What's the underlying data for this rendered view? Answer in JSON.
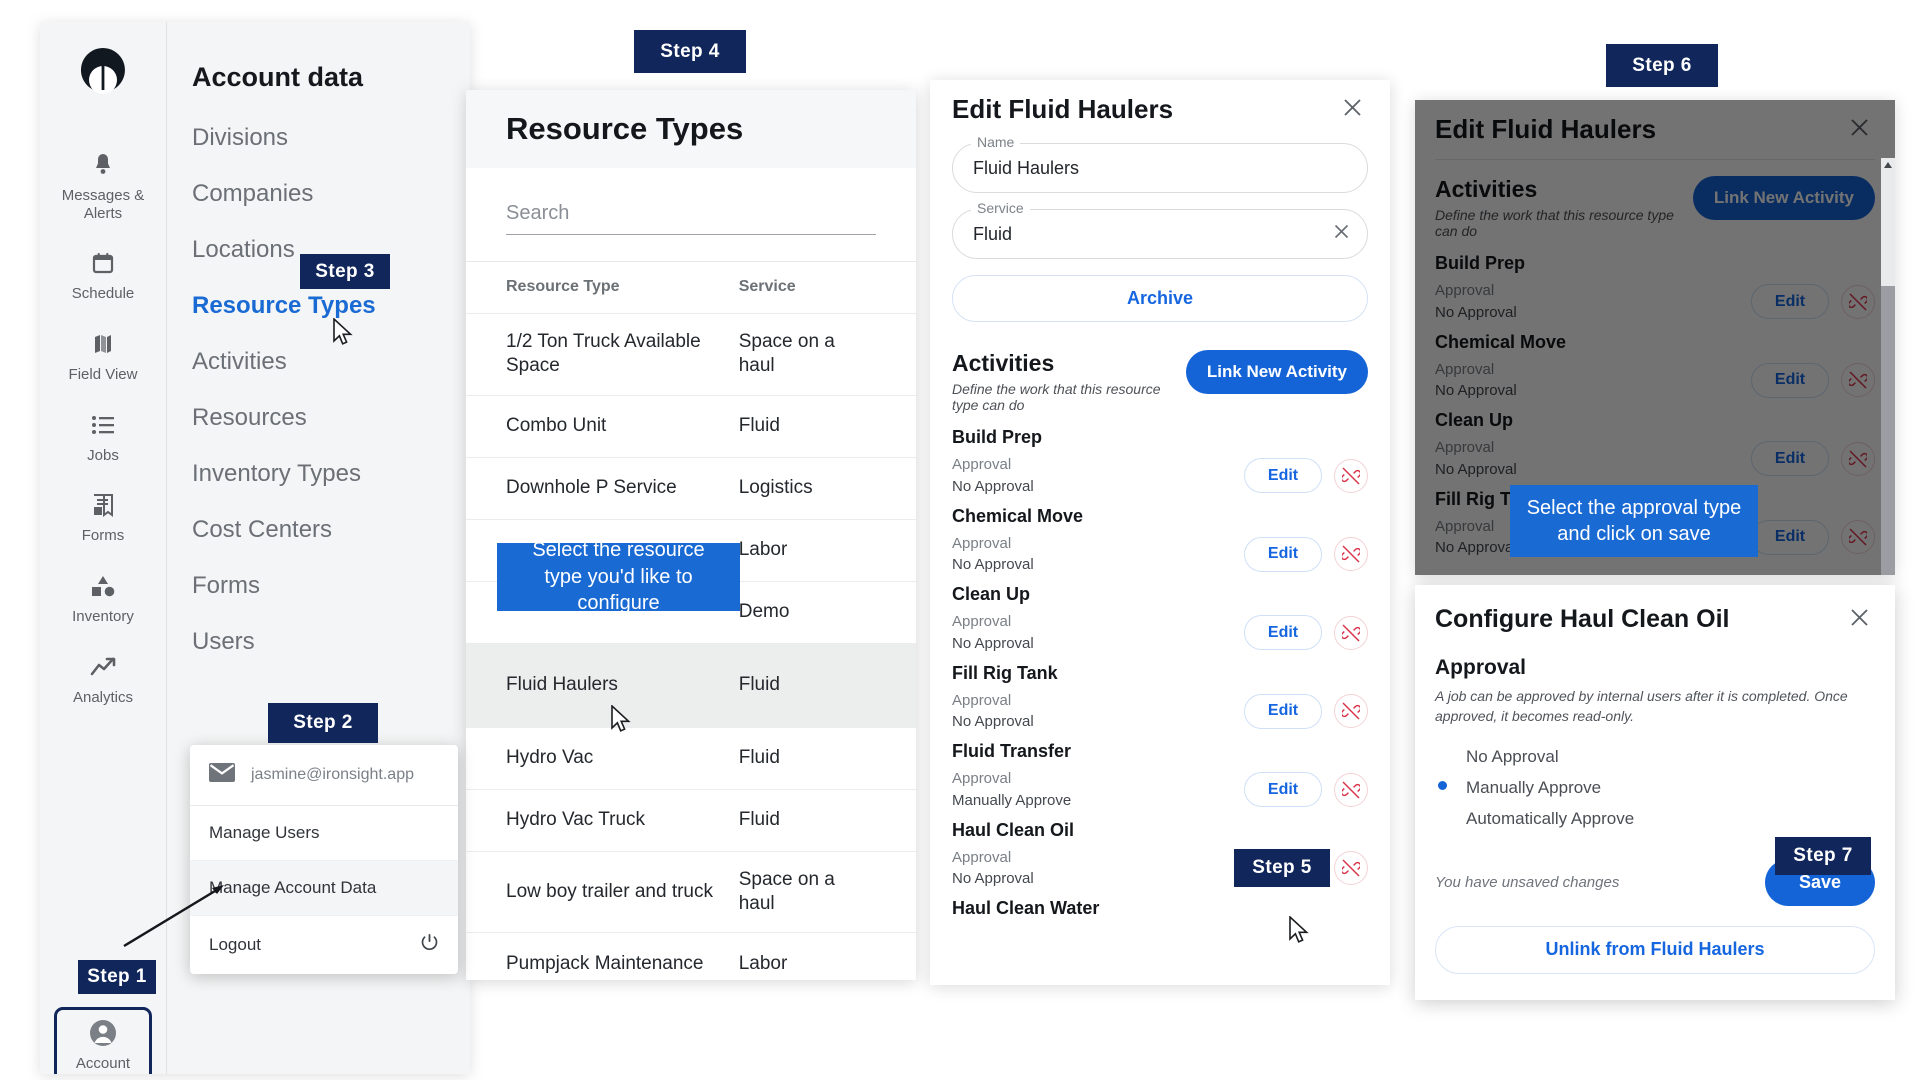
{
  "brand": {
    "accent_blue": "#1464d8",
    "navy": "#11265a",
    "tooltip_blue": "#1a6ad4",
    "danger_red": "#d9344a"
  },
  "sidebar": {
    "logo_icon": "ironsight-logo-icon",
    "items": [
      {
        "label": "Messages & Alerts",
        "icon": "bell-icon"
      },
      {
        "label": "Schedule",
        "icon": "calendar-icon"
      },
      {
        "label": "Field View",
        "icon": "map-icon"
      },
      {
        "label": "Jobs",
        "icon": "list-icon"
      },
      {
        "label": "Forms",
        "icon": "form-icon"
      },
      {
        "label": "Inventory",
        "icon": "shapes-icon"
      },
      {
        "label": "Analytics",
        "icon": "trending-up-icon"
      }
    ],
    "account": {
      "label": "Account",
      "icon": "user-circle-icon"
    }
  },
  "account_nav": {
    "title": "Account data",
    "items": [
      {
        "label": "Divisions",
        "active": false
      },
      {
        "label": "Companies",
        "active": false
      },
      {
        "label": "Locations",
        "active": false
      },
      {
        "label": "Resource Types",
        "active": true
      },
      {
        "label": "Activities",
        "active": false
      },
      {
        "label": "Resources",
        "active": false
      },
      {
        "label": "Inventory Types",
        "active": false
      },
      {
        "label": "Cost Centers",
        "active": false
      },
      {
        "label": "Forms",
        "active": false
      },
      {
        "label": "Users",
        "active": false
      }
    ]
  },
  "account_menu": {
    "email": "jasmine@ironsight.app",
    "email_icon": "mail-icon",
    "items": [
      {
        "label": "Manage Users",
        "highlighted": false,
        "icon": null
      },
      {
        "label": "Manage Account Data",
        "highlighted": true,
        "icon": null
      },
      {
        "label": "Logout",
        "highlighted": false,
        "icon": "power-icon"
      }
    ]
  },
  "resource_types": {
    "title": "Resource Types",
    "search_placeholder": "Search",
    "columns": [
      "Resource Type",
      "Service"
    ],
    "rows": [
      {
        "name": "1/2 Ton Truck Available Space",
        "service": "Space on a haul",
        "selected": false
      },
      {
        "name": "Combo Unit",
        "service": "Fluid",
        "selected": false
      },
      {
        "name": "Downhole P Service",
        "service": "Logistics",
        "selected": false
      },
      {
        "name": "",
        "service": "Labor",
        "selected": false
      },
      {
        "name": "",
        "service": "Demo",
        "selected": false
      },
      {
        "name": "Fluid Haulers",
        "service": "Fluid",
        "selected": true
      },
      {
        "name": "Hydro Vac",
        "service": "Fluid",
        "selected": false
      },
      {
        "name": "Hydro Vac Truck",
        "service": "Fluid",
        "selected": false
      },
      {
        "name": "Low boy trailer and truck",
        "service": "Space on a haul",
        "selected": false
      },
      {
        "name": "Pumpjack Maintenance",
        "service": "Labor",
        "selected": false
      }
    ]
  },
  "edit_panel": {
    "title": "Edit Fluid Haulers",
    "close_icon": "close-icon",
    "name_label": "Name",
    "name_value": "Fluid Haulers",
    "service_label": "Service",
    "service_value": "Fluid",
    "service_clear_icon": "clear-icon",
    "archive_label": "Archive",
    "activities_title": "Activities",
    "activities_subtitle": "Define the work that this resource type can do",
    "link_new_activity_label": "Link New Activity",
    "approval_label": "Approval",
    "edit_label": "Edit",
    "unlink_icon": "unlink-icon",
    "activities": [
      {
        "name": "Build Prep",
        "approval": "No Approval"
      },
      {
        "name": "Chemical Move",
        "approval": "No Approval"
      },
      {
        "name": "Clean Up",
        "approval": "No Approval"
      },
      {
        "name": "Fill Rig Tank",
        "approval": "No Approval"
      },
      {
        "name": "Fluid Transfer",
        "approval": "Manually Approve"
      },
      {
        "name": "Haul Clean Oil",
        "approval": "No Approval"
      },
      {
        "name": "Haul Clean Water",
        "approval": ""
      }
    ]
  },
  "dim_panel": {
    "title": "Edit Fluid Haulers",
    "close_icon": "close-icon",
    "activities_title": "Activities",
    "activities_subtitle": "Define the work that this resource type can do",
    "link_new_activity_label": "Link New Activity",
    "approval_label": "Approval",
    "edit_label": "Edit",
    "unlink_icon": "unlink-icon",
    "activities": [
      {
        "name": "Build Prep",
        "approval": "No Approval"
      },
      {
        "name": "Chemical Move",
        "approval": "No Approval"
      },
      {
        "name": "Clean Up",
        "approval": "No Approval"
      },
      {
        "name": "Fill Rig Tank",
        "approval": "No Approval"
      }
    ]
  },
  "configure_dialog": {
    "title": "Configure Haul Clean Oil",
    "close_icon": "close-icon",
    "section_title": "Approval",
    "description": "A job can be approved by internal users after it is completed. Once approved, it becomes read-only.",
    "options": [
      {
        "label": "No Approval",
        "selected": false
      },
      {
        "label": "Manually Approve",
        "selected": true
      },
      {
        "label": "Automatically Approve",
        "selected": false
      }
    ],
    "unsaved_text": "You have unsaved changes",
    "save_label": "Save",
    "unlink_label": "Unlink from Fluid Haulers"
  },
  "steps": {
    "s1": "Step 1",
    "s2": "Step 2",
    "s3": "Step 3",
    "s4": "Step 4",
    "s5": "Step 5",
    "s6": "Step 6",
    "s7": "Step 7"
  },
  "tooltips": {
    "resource_type": "Select the resource type you'd like to configure",
    "approval_type": "Select the approval type and click on save"
  }
}
